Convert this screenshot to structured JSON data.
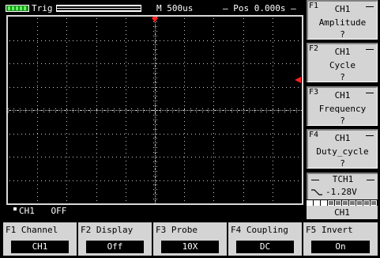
{
  "top_bar": {
    "trig_label": "Trig",
    "timebase": "M 500us",
    "position": "— Pos  0.000s —"
  },
  "channel_status": {
    "channel": "CH1",
    "state": "OFF"
  },
  "colors": {
    "marker": "#ff2020",
    "grid_dots": "#c8c8c8",
    "panel_bg": "#d4d4d4",
    "run_indicator": "#1c8a1c"
  },
  "measure_panel": [
    {
      "key": "F1",
      "channel": "CH1",
      "name": "Amplitude",
      "value": "?"
    },
    {
      "key": "F2",
      "channel": "CH1",
      "name": "Cycle",
      "value": "?"
    },
    {
      "key": "F3",
      "channel": "CH1",
      "name": "Frequency",
      "value": "?"
    },
    {
      "key": "F4",
      "channel": "CH1",
      "name": "Duty_cycle",
      "value": "?"
    }
  ],
  "trigger_panel": {
    "source": "TCH1",
    "level": "-1.28V",
    "edge_icon": "falling-edge-icon"
  },
  "segment_indicator": {
    "lit": 3,
    "total": 10
  },
  "channel_indicator": "CH1",
  "menu": [
    {
      "label": "F1 Channel",
      "value": "CH1"
    },
    {
      "label": "F2 Display",
      "value": "Off"
    },
    {
      "label": "F3  Probe",
      "value": "10X"
    },
    {
      "label": "F4 Coupling",
      "value": "DC"
    },
    {
      "label": "F5  Invert",
      "value": "On"
    }
  ]
}
